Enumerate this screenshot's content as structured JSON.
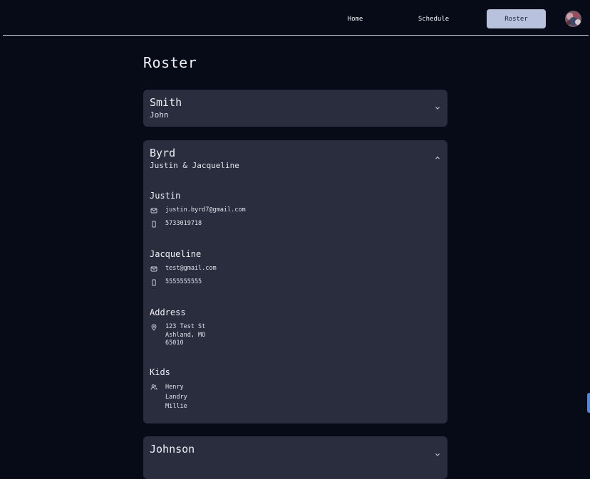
{
  "nav": {
    "home": "Home",
    "schedule": "Schedule",
    "roster": "Roster"
  },
  "page": {
    "title": "Roster"
  },
  "families": [
    {
      "name": "Smith",
      "members": "John",
      "expanded": false
    },
    {
      "name": "Byrd",
      "members": "Justin & Jacqueline",
      "expanded": true,
      "people": [
        {
          "name": "Justin",
          "email": "justin.byrd7@gmail.com",
          "phone": "5733019718"
        },
        {
          "name": "Jacqueline",
          "email": "test@gmail.com",
          "phone": "5555555555"
        }
      ],
      "address_title": "Address",
      "address": [
        "123 Test St",
        "Ashland, MO",
        "65010"
      ],
      "kids_title": "Kids",
      "kids": [
        "Henry",
        "Landry",
        "Millie"
      ]
    },
    {
      "name": "Johnson",
      "expanded": false
    }
  ],
  "icons": {
    "email": "mail-icon",
    "phone": "phone-icon",
    "address": "map-pin-icon",
    "kids": "users-icon"
  },
  "colors": {
    "background": "#070b18",
    "card": "#2a2d3e",
    "active_nav": "#b9c2dc",
    "scroll_accent": "#4f86e8"
  }
}
